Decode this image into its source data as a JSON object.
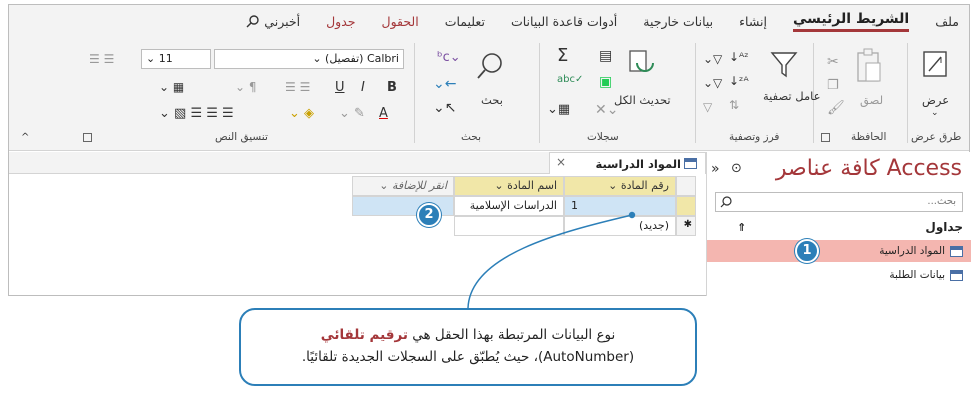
{
  "tabs": [
    {
      "label": "ملف",
      "style": "normal"
    },
    {
      "label": "الشريط الرئيسي",
      "style": "active"
    },
    {
      "label": "إنشاء",
      "style": "normal"
    },
    {
      "label": "بيانات خارجية",
      "style": "normal"
    },
    {
      "label": "أدوات قاعدة البيانات",
      "style": "normal"
    },
    {
      "label": "تعليمات",
      "style": "normal"
    },
    {
      "label": "الحقول",
      "style": "red"
    },
    {
      "label": "جدول",
      "style": "red"
    }
  ],
  "tell_me": "أخبرني",
  "ribbon": {
    "views": {
      "view_label": "عرض",
      "group": "طرق عرض"
    },
    "clipboard": {
      "paste_label": "لصق",
      "group": "الحافظة"
    },
    "sort_filter": {
      "filter_label": "عامل تصفية",
      "group": "فرز وتصفية"
    },
    "records": {
      "refresh_label": "تحديث الكل",
      "group": "سجلات"
    },
    "find": {
      "find_label": "بحث",
      "group": "بحث"
    },
    "text_format": {
      "font": "Calbri (تفصيل)",
      "size": "11",
      "group": "تنسيق النص"
    }
  },
  "nav": {
    "title": "كافة عناصر Access",
    "search_placeholder": "بحث...",
    "section": "جداول",
    "items": [
      "المواد الدراسية",
      "بيانات الطلبة"
    ]
  },
  "document_tab": "المواد الدراسية",
  "datasheet": {
    "headers": [
      "رقم المادة",
      "اسم المادة",
      "انقر للإضافة"
    ],
    "row1": [
      "1",
      "الدراسات الإسلامية"
    ],
    "new_row": "(جديد)"
  },
  "badges": [
    "1",
    "2"
  ],
  "callout": {
    "line1_prefix": "نوع البيانات المرتبطة بهذا الحقل هي ",
    "line1_bold": "ترقيم تلقائي",
    "line2": "(AutoNumber)، حيث يُطبّق على السجلات الجديدة تلقائيًا."
  },
  "colors": {
    "accent": "#a4373a",
    "callout": "#2c7fb8",
    "header": "#f1e7a8",
    "nav_selected": "#f4b6b0"
  }
}
